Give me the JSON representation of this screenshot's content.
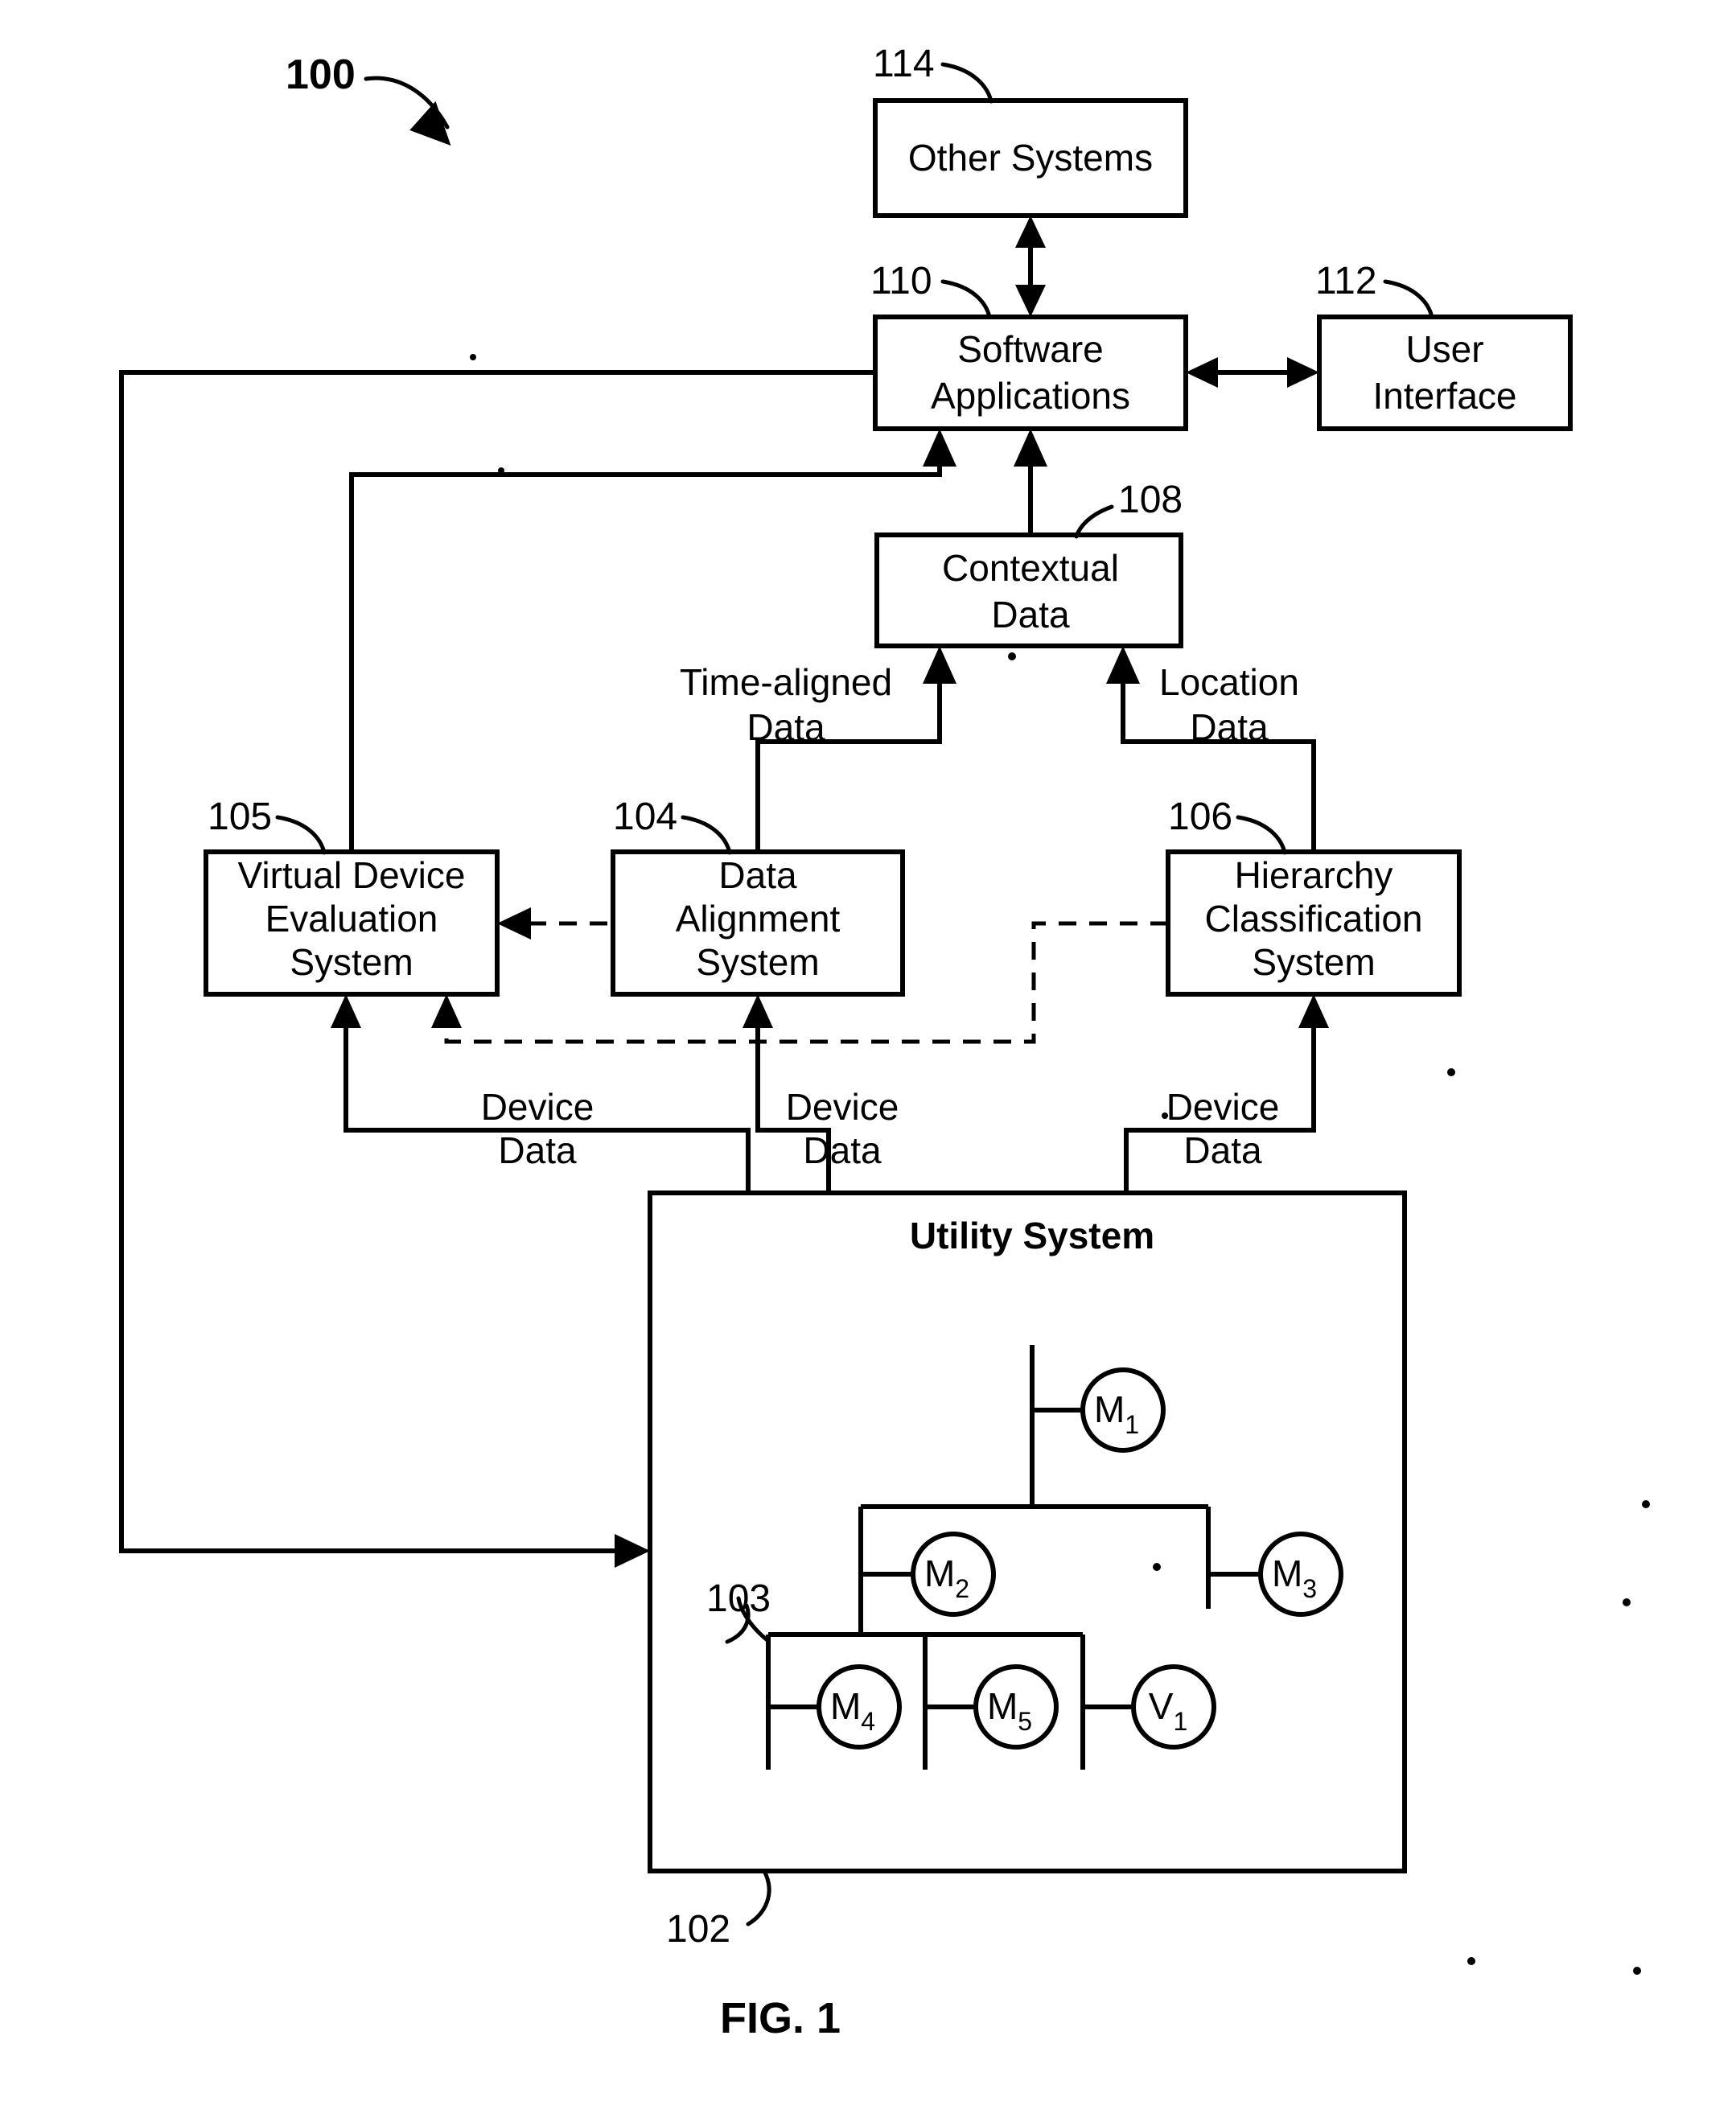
{
  "figure": {
    "caption": "FIG. 1",
    "system_ref": "100"
  },
  "boxes": [
    {
      "id": "other_systems",
      "ref": "114",
      "lines": [
        "Other Systems"
      ]
    },
    {
      "id": "software_apps",
      "ref": "110",
      "lines": [
        "Software",
        "Applications"
      ]
    },
    {
      "id": "user_interface",
      "ref": "112",
      "lines": [
        "User",
        "Interface"
      ]
    },
    {
      "id": "contextual_data",
      "ref": "108",
      "lines": [
        "Contextual",
        "Data"
      ]
    },
    {
      "id": "virtual_device",
      "ref": "105",
      "lines": [
        "Virtual Device",
        "Evaluation",
        "System"
      ]
    },
    {
      "id": "data_alignment",
      "ref": "104",
      "lines": [
        "Data",
        "Alignment",
        "System"
      ]
    },
    {
      "id": "hierarchy_class",
      "ref": "106",
      "lines": [
        "Hierarchy",
        "Classification",
        "System"
      ]
    },
    {
      "id": "utility_system",
      "ref": "102",
      "lines": [
        "Utility System"
      ]
    }
  ],
  "edge_labels": {
    "time_aligned": [
      "Time-aligned",
      "Data"
    ],
    "location": [
      "Location",
      "Data"
    ],
    "device_left": [
      "Device",
      "Data"
    ],
    "device_mid": [
      "Device",
      "Data"
    ],
    "device_right": [
      "Device",
      "Data"
    ]
  },
  "utility": {
    "title": "Utility System",
    "subgroup_ref": "103",
    "box_ref": "102",
    "devices": [
      {
        "id": "m1",
        "base": "M",
        "sub": "1"
      },
      {
        "id": "m2",
        "base": "M",
        "sub": "2"
      },
      {
        "id": "m3",
        "base": "M",
        "sub": "3"
      },
      {
        "id": "m4",
        "base": "M",
        "sub": "4"
      },
      {
        "id": "m5",
        "base": "M",
        "sub": "5"
      },
      {
        "id": "v1",
        "base": "V",
        "sub": "1"
      }
    ]
  },
  "colors": {
    "ink": "#000000",
    "paper": "#ffffff"
  }
}
